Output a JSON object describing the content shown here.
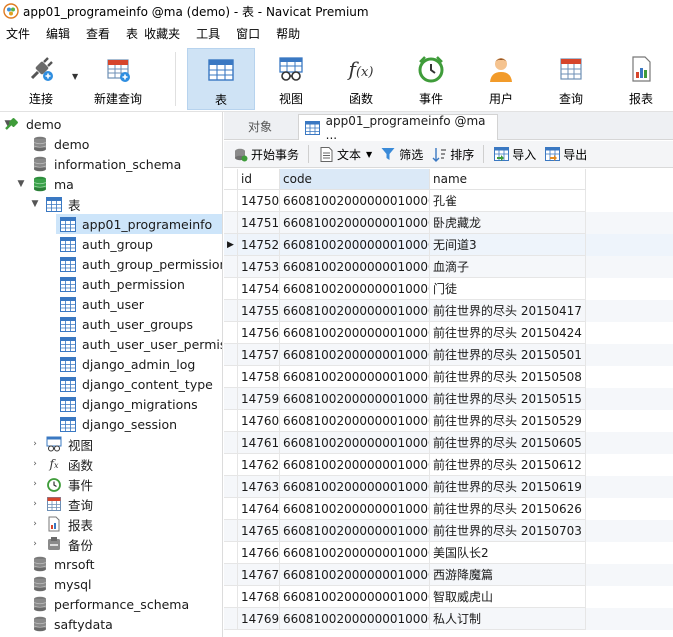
{
  "window": {
    "title": "app01_programeinfo @ma (demo) - 表 - Navicat Premium"
  },
  "menu": [
    "文件",
    "编辑",
    "查看",
    "表",
    "收藏夹",
    "工具",
    "窗口",
    "帮助"
  ],
  "toolbar": {
    "connect": "连接",
    "new_query": "新建查询",
    "table": "表",
    "view": "视图",
    "function": "函数",
    "event": "事件",
    "user": "用户",
    "query": "查询",
    "report": "报表"
  },
  "tree": {
    "root": "demo",
    "demo_db": "demo",
    "info_schema": "information_schema",
    "ma": "ma",
    "tables_group": "表",
    "tables": [
      "app01_programeinfo",
      "auth_group",
      "auth_group_permissions",
      "auth_permission",
      "auth_user",
      "auth_user_groups",
      "auth_user_user_permissi",
      "django_admin_log",
      "django_content_type",
      "django_migrations",
      "django_session"
    ],
    "views": "视图",
    "functions": "函数",
    "events": "事件",
    "queries": "查询",
    "reports": "报表",
    "backups": "备份",
    "other_dbs": [
      "mrsoft",
      "mysql",
      "performance_schema",
      "saftydata"
    ]
  },
  "tabs": {
    "objects": "对象",
    "active": "app01_programeinfo @ma ..."
  },
  "subtoolbar": {
    "begin_tx": "开始事务",
    "text": "文本",
    "filter": "筛选",
    "sort": "排序",
    "import": "导入",
    "export": "导出"
  },
  "grid": {
    "columns": [
      "id",
      "code",
      "name"
    ],
    "rows": [
      [
        "14750",
        "66081002000000010000",
        "孔雀"
      ],
      [
        "14751",
        "66081002000000010000",
        "卧虎藏龙"
      ],
      [
        "14752",
        "66081002000000010000",
        "无间道3"
      ],
      [
        "14753",
        "66081002000000010000",
        "血滴子"
      ],
      [
        "14754",
        "66081002000000010000",
        "门徒"
      ],
      [
        "14755",
        "66081002000000010000",
        "前往世界的尽头 20150417"
      ],
      [
        "14756",
        "66081002000000010000",
        "前往世界的尽头 20150424"
      ],
      [
        "14757",
        "66081002000000010000",
        "前往世界的尽头 20150501"
      ],
      [
        "14758",
        "66081002000000010000",
        "前往世界的尽头 20150508"
      ],
      [
        "14759",
        "66081002000000010000",
        "前往世界的尽头 20150515"
      ],
      [
        "14760",
        "66081002000000010000",
        "前往世界的尽头 20150529"
      ],
      [
        "14761",
        "66081002000000010000",
        "前往世界的尽头 20150605"
      ],
      [
        "14762",
        "66081002000000010000",
        "前往世界的尽头 20150612"
      ],
      [
        "14763",
        "66081002000000010000",
        "前往世界的尽头 20150619"
      ],
      [
        "14764",
        "66081002000000010000",
        "前往世界的尽头 20150626"
      ],
      [
        "14765",
        "66081002000000010000",
        "前往世界的尽头 20150703"
      ],
      [
        "14766",
        "66081002000000010000",
        "美国队长2"
      ],
      [
        "14767",
        "66081002000000010000",
        "西游降魔篇"
      ],
      [
        "14768",
        "66081002000000010000",
        "智取威虎山"
      ],
      [
        "14769",
        "66081002000000010000",
        "私人订制"
      ]
    ],
    "current_row_index": 2
  },
  "colors": {
    "accent": "#cfe3f5",
    "selection": "#cde5fa",
    "db_green": "#3aa14a"
  }
}
